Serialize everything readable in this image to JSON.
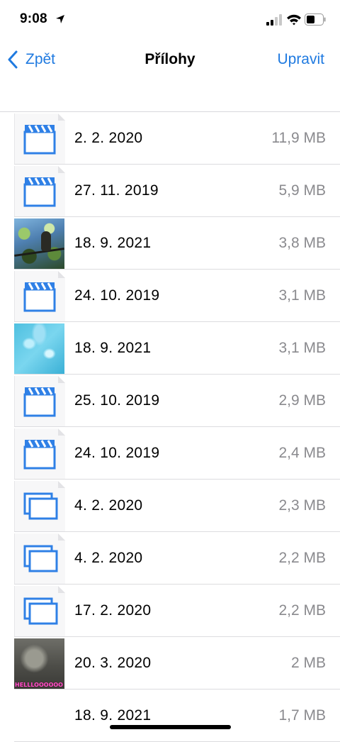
{
  "status_bar": {
    "time": "9:08"
  },
  "nav": {
    "back_label": "Zpět",
    "title": "Přílohy",
    "edit_label": "Upravit"
  },
  "attachments": [
    {
      "date": "2. 2. 2020",
      "size": "11,9 MB",
      "kind": "video",
      "icon": "video-clapper-icon"
    },
    {
      "date": "27. 11. 2019",
      "size": "5,9 MB",
      "kind": "video",
      "icon": "video-clapper-icon"
    },
    {
      "date": "18. 9. 2021",
      "size": "3,8 MB",
      "kind": "photo",
      "icon": "photo-thumbnail"
    },
    {
      "date": "24. 10. 2019",
      "size": "3,1 MB",
      "kind": "video",
      "icon": "video-clapper-icon"
    },
    {
      "date": "18. 9. 2021",
      "size": "3,1 MB",
      "kind": "photo",
      "icon": "photo-thumbnail"
    },
    {
      "date": "25. 10. 2019",
      "size": "2,9 MB",
      "kind": "video",
      "icon": "video-clapper-icon"
    },
    {
      "date": "24. 10. 2019",
      "size": "2,4 MB",
      "kind": "video",
      "icon": "video-clapper-icon"
    },
    {
      "date": "4. 2. 2020",
      "size": "2,3 MB",
      "kind": "stack",
      "icon": "image-stack-icon"
    },
    {
      "date": "4. 2. 2020",
      "size": "2,2 MB",
      "kind": "stack",
      "icon": "image-stack-icon"
    },
    {
      "date": "17. 2. 2020",
      "size": "2,2 MB",
      "kind": "stack",
      "icon": "image-stack-icon"
    },
    {
      "date": "20. 3. 2020",
      "size": "2 MB",
      "kind": "photo",
      "icon": "photo-thumbnail",
      "caption": "HELLLOOOOOO!"
    },
    {
      "date": "18. 9. 2021",
      "size": "1,7 MB",
      "kind": "none"
    }
  ],
  "colors": {
    "accent": "#1f7ae0",
    "secondary_text": "#8a8a8e"
  }
}
